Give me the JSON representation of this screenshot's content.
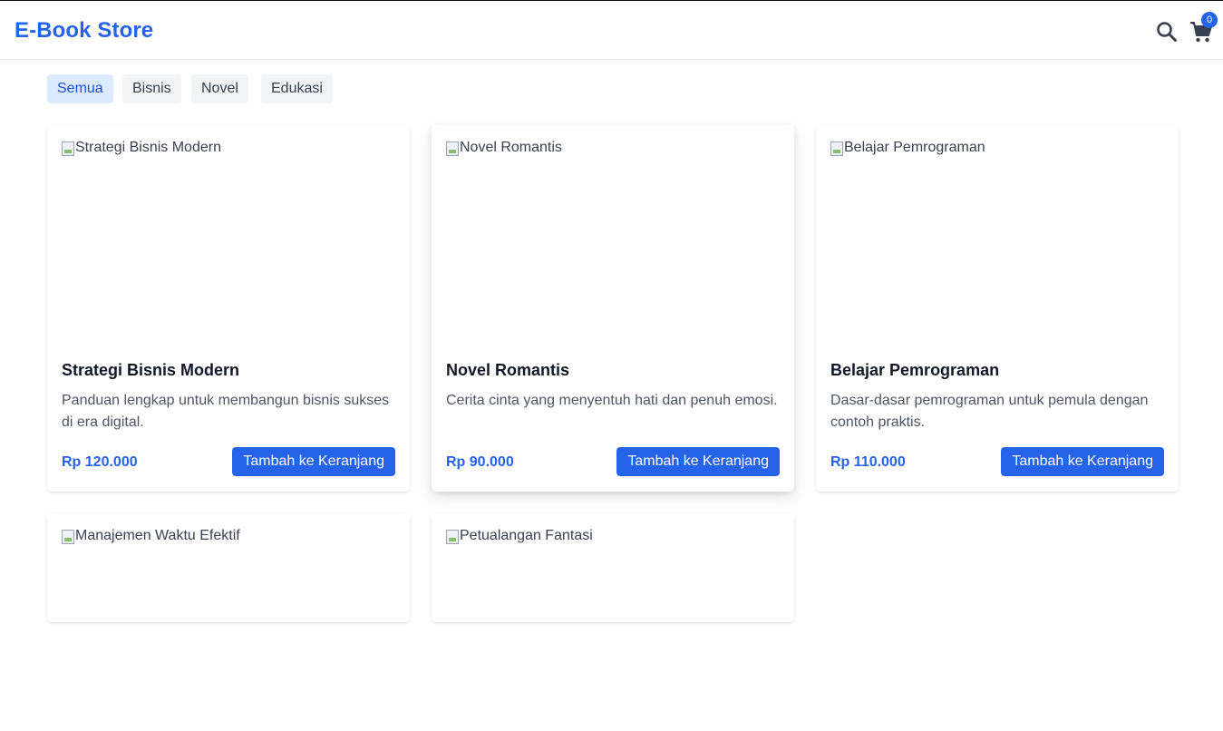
{
  "header": {
    "brand": "E-Book Store",
    "cart_count": "0"
  },
  "filters": [
    {
      "label": "Semua",
      "active": true
    },
    {
      "label": "Bisnis",
      "active": false
    },
    {
      "label": "Novel",
      "active": false
    },
    {
      "label": "Edukasi",
      "active": false
    }
  ],
  "books": [
    {
      "image_alt": "Strategi Bisnis Modern",
      "title": "Strategi Bisnis Modern",
      "description": "Panduan lengkap untuk membangun bisnis sukses di era digital.",
      "price": "Rp 120.000",
      "button": "Tambah ke Keranjang"
    },
    {
      "image_alt": "Novel Romantis",
      "title": "Novel Romantis",
      "description": "Cerita cinta yang menyentuh hati dan penuh emosi.",
      "price": "Rp 90.000",
      "button": "Tambah ke Keranjang"
    },
    {
      "image_alt": "Belajar Pemrograman",
      "title": "Belajar Pemrograman",
      "description": "Dasar-dasar pemrograman untuk pemula dengan contoh praktis.",
      "price": "Rp 110.000",
      "button": "Tambah ke Keranjang"
    },
    {
      "image_alt": "Manajemen Waktu Efektif"
    },
    {
      "image_alt": "Petualangan Fantasi"
    }
  ],
  "icons": {
    "search": "search-icon",
    "cart": "shopping-cart-icon"
  },
  "colors": {
    "accent": "#2563eb",
    "chip_active_bg": "#dbeafe",
    "chip_bg": "#f3f4f6"
  }
}
